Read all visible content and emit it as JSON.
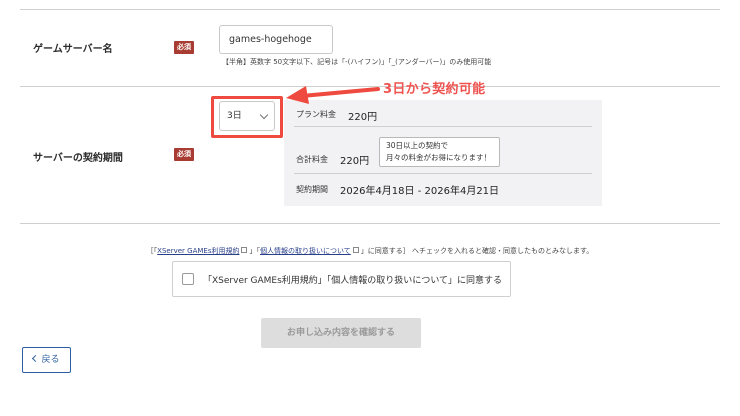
{
  "server_name": {
    "label": "ゲームサーバー名",
    "required_badge": "必須",
    "value": "games-hogehoge",
    "hint": "【半角】英数字 50文字以下、記号は「-(ハイフン)」「_(アンダーバー)」のみ使用可能"
  },
  "annotation": {
    "text": "3日から契約可能",
    "color": "#ef4a40"
  },
  "contract": {
    "label": "サーバーの契約期間",
    "required_badge": "必須",
    "period_select": "3日",
    "plan_fee_label": "プラン料金",
    "plan_fee_value": "220円",
    "total_fee_label": "合計料金",
    "total_fee_value": "220円",
    "note_line1": "30日以上の契約で",
    "note_line2": "月々の料金がお得になります！",
    "term_label": "契約期間",
    "term_value": "2026年4月18日 - 2026年4月21日"
  },
  "agreement": {
    "bracket_open": "［「",
    "terms_link": "XServer GAMEs利用規約",
    "mid": "」「",
    "privacy_link": "個人情報の取り扱いについて",
    "rest": "」に同意する］ へチェックを入れると確認・同意したものとみなします。",
    "checkbox_label": "「XServer GAMEs利用規約」「個人情報の取り扱いについて」に同意する",
    "checked": false
  },
  "buttons": {
    "confirm": "お申し込み内容を確認する",
    "back": "戻る"
  },
  "colors": {
    "badge": "#a83b32",
    "annotation": "#ef4a40",
    "link": "#2a3f8a",
    "back_button": "#2f5fa0"
  }
}
